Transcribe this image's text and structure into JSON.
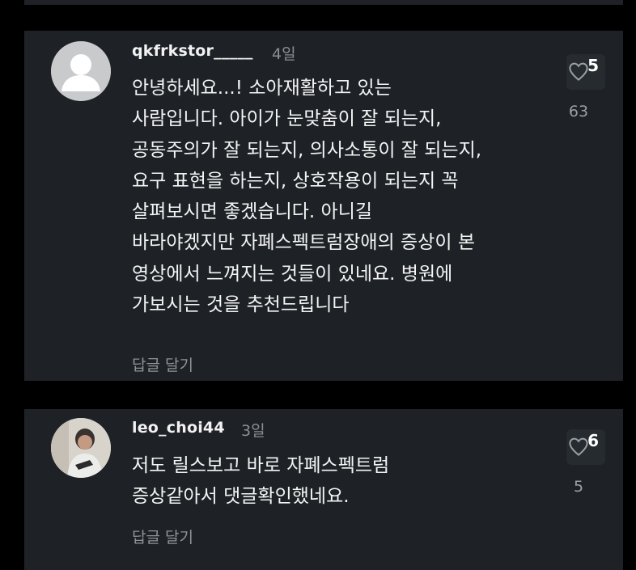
{
  "comments": [
    {
      "username": "qkfrkstor_____",
      "time": "4일",
      "lines": [
        "안녕하세요...! 소아재활하고 있는",
        "사람입니다. 아이가 눈맞춤이 잘 되는지,",
        "공동주의가 잘 되는지, 의사소통이 잘 되는지,",
        "요구 표현을 하는지, 상호작용이 되는지 꼭",
        "살펴보시면 좋겠습니다. 아니길",
        "바라야겠지만 자폐스펙트럼장애의 증상이 본",
        "영상에서 느껴지는 것들이 있네요. 병원에",
        "가보시는 것을 추천드립니다"
      ],
      "reply_label": "답글 달기",
      "like_badge": "5",
      "like_count": "63",
      "heart_icon": "heart-outline-icon",
      "avatar_icon": "default-avatar-icon"
    },
    {
      "username": "leo_choi44",
      "time": "3일",
      "lines": [
        "저도 릴스보고 바로 자폐스펙트럼",
        "증상같아서 댓글확인했네요."
      ],
      "reply_label": "답글 달기",
      "like_badge": "6",
      "like_count": "5",
      "heart_icon": "heart-outline-icon",
      "avatar_icon": "profile-photo-avatar"
    }
  ],
  "colors": {
    "background": "#000000",
    "card": "#1e2226",
    "text": "#f4f4f4",
    "muted": "#8e9398"
  }
}
